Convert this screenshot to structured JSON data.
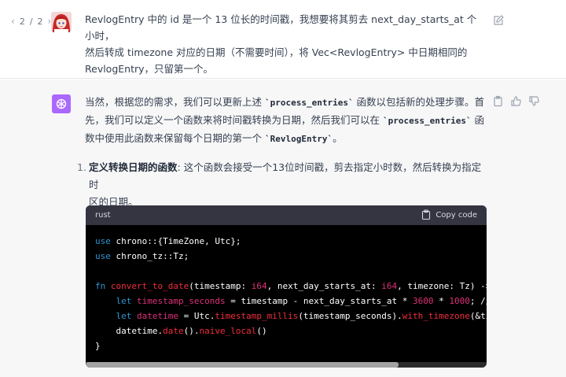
{
  "user_message": {
    "pager": {
      "current": "2",
      "separator": "/",
      "total": "2"
    },
    "lines": [
      "RevlogEntry 中的 id 是一个 13 位长的时间戳，我想要将其剪去 next_day_starts_at 个小时，",
      "然后转成 timezone 对应的日期（不需要时间），将 Vec<RevlogEntry> 中日期相同的",
      "RevlogEntry，只留第一个。"
    ]
  },
  "assistant_message": {
    "para": {
      "line1": "当然，根据您的需求，我们可以更新上述 ",
      "code1": "`process_entries`",
      "line1b": " 函数以包括新的处理步骤。首",
      "line2": "先，我们可以定义一个函数来将时间戳转换为日期，然后我们可以在 ",
      "code2": "`process_entries`",
      "line2b": " 函",
      "line3": "数中使用此函数来保留每个日期的第一个 ",
      "code3": "`RevlogEntry`",
      "line3b": "。"
    },
    "list_item": {
      "number": "1.",
      "bold": "定义转换日期的函数",
      "text1": ": 这个函数会接受一个13位时间戳，剪去指定小时数，然后转换为指定时",
      "text2": "区的日期。"
    },
    "code_block": {
      "language": "rust",
      "copy_label": "Copy code",
      "lines": [
        [
          {
            "t": "use",
            "c": "#2e95d3"
          },
          {
            "t": " chrono::{TimeZone, Utc};",
            "c": "#ffffff"
          }
        ],
        [
          {
            "t": "use",
            "c": "#2e95d3"
          },
          {
            "t": " chrono_tz::Tz;",
            "c": "#ffffff"
          }
        ],
        [],
        [
          {
            "t": "fn",
            "c": "#2e95d3"
          },
          {
            "t": " ",
            "c": "#ffffff"
          },
          {
            "t": "convert_to_date",
            "c": "#f22c3d"
          },
          {
            "t": "(timestamp: ",
            "c": "#ffffff"
          },
          {
            "t": "i64",
            "c": "#df3079"
          },
          {
            "t": ", next_day_starts_at: ",
            "c": "#ffffff"
          },
          {
            "t": "i64",
            "c": "#df3079"
          },
          {
            "t": ", timezone: Tz) ->",
            "c": "#ffffff"
          }
        ],
        [
          {
            "t": "    ",
            "c": "#ffffff"
          },
          {
            "t": "let",
            "c": "#2e95d3"
          },
          {
            "t": " ",
            "c": "#ffffff"
          },
          {
            "t": "timestamp_seconds",
            "c": "#df3079"
          },
          {
            "t": " = timestamp - next_day_starts_at * ",
            "c": "#ffffff"
          },
          {
            "t": "3600",
            "c": "#df3079"
          },
          {
            "t": " * ",
            "c": "#ffffff"
          },
          {
            "t": "1000",
            "c": "#df3079"
          },
          {
            "t": "; //",
            "c": "#ffffff"
          }
        ],
        [
          {
            "t": "    ",
            "c": "#ffffff"
          },
          {
            "t": "let",
            "c": "#2e95d3"
          },
          {
            "t": " ",
            "c": "#ffffff"
          },
          {
            "t": "datetime",
            "c": "#df3079"
          },
          {
            "t": " = Utc.",
            "c": "#ffffff"
          },
          {
            "t": "timestamp_millis",
            "c": "#f22c3d"
          },
          {
            "t": "(timestamp_seconds).",
            "c": "#ffffff"
          },
          {
            "t": "with_timezone",
            "c": "#f22c3d"
          },
          {
            "t": "(&ti",
            "c": "#ffffff"
          }
        ],
        [
          {
            "t": "    datetime.",
            "c": "#ffffff"
          },
          {
            "t": "date",
            "c": "#f22c3d"
          },
          {
            "t": "().",
            "c": "#ffffff"
          },
          {
            "t": "naive_local",
            "c": "#f22c3d"
          },
          {
            "t": "()",
            "c": "#ffffff"
          }
        ],
        [
          {
            "t": "}",
            "c": "#ffffff"
          }
        ]
      ]
    },
    "horizontal_scroll_fraction": 0.78
  },
  "icons": {
    "prev": "chevron-left-icon",
    "next": "chevron-right-icon",
    "edit": "edit-icon",
    "copy": "clipboard-icon",
    "thumbs_up": "thumbs-up-icon",
    "thumbs_down": "thumbs-down-icon",
    "assistant": "openai-logo-icon"
  },
  "colors": {
    "assistant_avatar": "#ab68ff",
    "keyword": "#2e95d3",
    "function": "#f22c3d",
    "literal": "#df3079",
    "code_bg": "#000000",
    "code_header_bg": "#343541"
  }
}
